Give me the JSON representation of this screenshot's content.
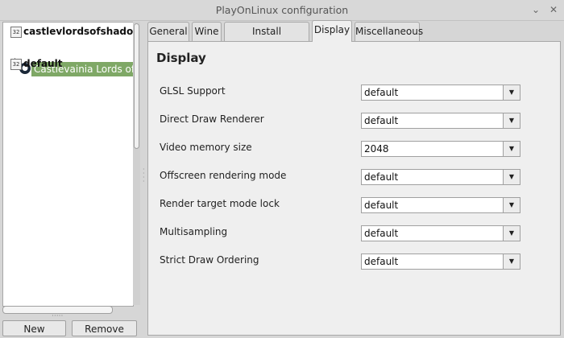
{
  "window": {
    "title": "PlayOnLinux configuration",
    "minimize_glyph": "⌄",
    "close_glyph": "✕"
  },
  "tree": {
    "prefixes": [
      {
        "badge": "32",
        "name": "castlevlordsofshadow"
      },
      {
        "badge": "32",
        "name": "default"
      }
    ],
    "child": {
      "name": "Castlevainia Lords of Shadow",
      "icon": "steam-icon"
    }
  },
  "buttons": {
    "new_label": "New",
    "remove_label": "Remove"
  },
  "tabs": [
    "General",
    "Wine",
    "Install components",
    "Display",
    "Miscellaneous"
  ],
  "active_tab": "Display",
  "display": {
    "title": "Display",
    "settings": [
      {
        "label": "GLSL Support",
        "value": "default"
      },
      {
        "label": "Direct Draw Renderer",
        "value": "default"
      },
      {
        "label": "Video memory size",
        "value": "2048"
      },
      {
        "label": "Offscreen rendering mode",
        "value": "default"
      },
      {
        "label": "Render target mode lock",
        "value": "default"
      },
      {
        "label": "Multisampling",
        "value": "default"
      },
      {
        "label": "Strict Draw Ordering",
        "value": "default"
      }
    ]
  },
  "colors": {
    "selection": "#7fa866",
    "window_bg": "#d6d6d6",
    "panel_bg": "#efefef"
  }
}
